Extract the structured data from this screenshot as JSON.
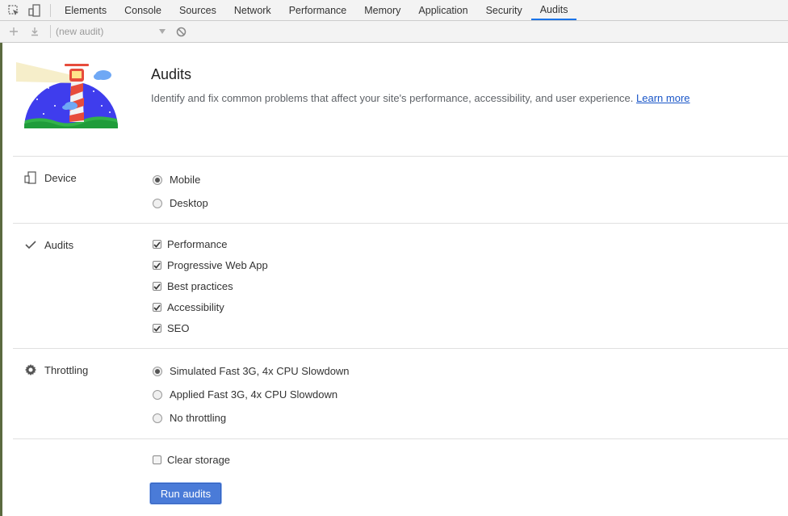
{
  "devtools": {
    "tabs": [
      "Elements",
      "Console",
      "Sources",
      "Network",
      "Performance",
      "Memory",
      "Application",
      "Security",
      "Audits"
    ],
    "active_tab": "Audits"
  },
  "toolbar": {
    "audit_select": "(new audit)"
  },
  "header": {
    "title": "Audits",
    "description": "Identify and fix common problems that affect your site's performance, accessibility, and user experience.",
    "learn_more": "Learn more"
  },
  "device": {
    "label": "Device",
    "options": [
      {
        "label": "Mobile",
        "selected": true
      },
      {
        "label": "Desktop",
        "selected": false
      }
    ]
  },
  "audits": {
    "label": "Audits",
    "options": [
      {
        "label": "Performance",
        "checked": true
      },
      {
        "label": "Progressive Web App",
        "checked": true
      },
      {
        "label": "Best practices",
        "checked": true
      },
      {
        "label": "Accessibility",
        "checked": true
      },
      {
        "label": "SEO",
        "checked": true
      }
    ]
  },
  "throttling": {
    "label": "Throttling",
    "options": [
      {
        "label": "Simulated Fast 3G, 4x CPU Slowdown",
        "selected": true
      },
      {
        "label": "Applied Fast 3G, 4x CPU Slowdown",
        "selected": false
      },
      {
        "label": "No throttling",
        "selected": false
      }
    ]
  },
  "clear_storage": {
    "label": "Clear storage",
    "checked": false
  },
  "run_button": "Run audits",
  "colors": {
    "accent": "#1a73e8",
    "run_button": "#4a7bd8",
    "logo_bg": "#3f3ded"
  }
}
